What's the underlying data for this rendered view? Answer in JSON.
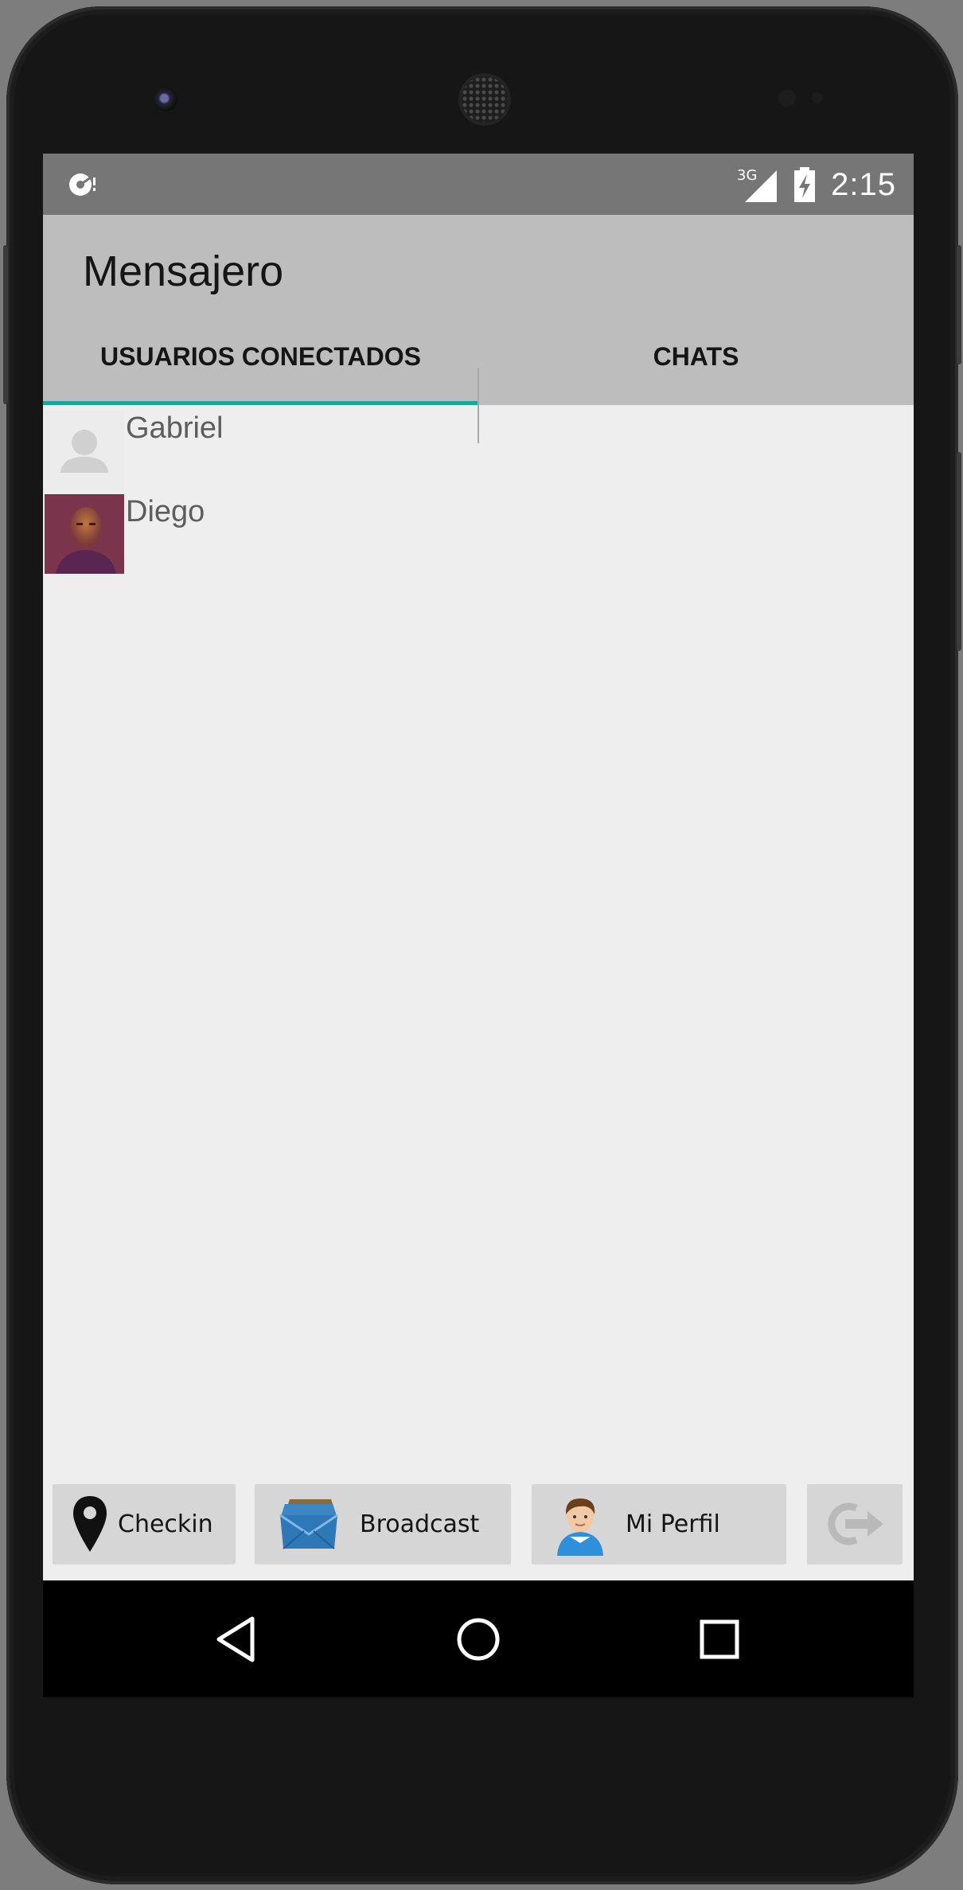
{
  "status_bar": {
    "time": "2:15",
    "network": "3G"
  },
  "app": {
    "title": "Mensajero"
  },
  "tabs": [
    {
      "label": "USUARIOS CONECTADOS",
      "selected": true
    },
    {
      "label": "CHATS",
      "selected": false
    }
  ],
  "users": [
    {
      "name": "Gabriel",
      "avatar": "default-person-icon"
    },
    {
      "name": "Diego",
      "avatar": "photo"
    }
  ],
  "bottom_buttons": {
    "checkin": {
      "label": "Checkin",
      "icon": "map-pin-icon"
    },
    "broadcast": {
      "label": "Broadcast",
      "icon": "envelopes-icon"
    },
    "profile": {
      "label": "Mi Perfil",
      "icon": "user-avatar-icon"
    },
    "logout": {
      "icon": "logout-arrow-icon"
    }
  },
  "colors": {
    "accent": "#1aa79a",
    "appbar": "#bdbdbd",
    "statusbar": "#767676",
    "background": "#eeeeee"
  }
}
